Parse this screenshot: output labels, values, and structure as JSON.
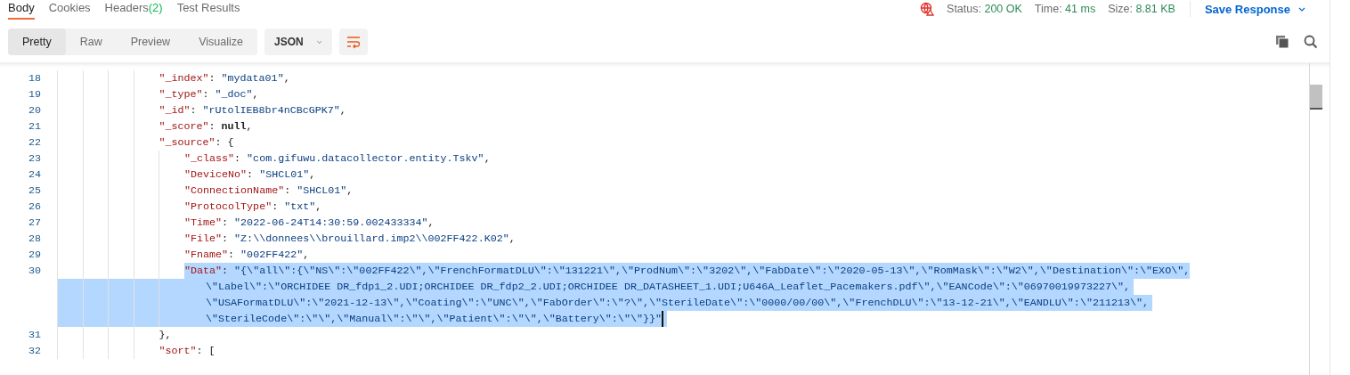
{
  "response_tabs": [
    {
      "label": "Body",
      "selected": true
    },
    {
      "label": "Cookies",
      "selected": false
    },
    {
      "label": "Headers",
      "count": "(2)",
      "selected": false
    },
    {
      "label": "Test Results",
      "selected": false
    }
  ],
  "status": [
    {
      "label": "Status:",
      "value": "200 OK"
    },
    {
      "label": "Time:",
      "value": "41 ms"
    },
    {
      "label": "Size:",
      "value": "8.81 KB"
    }
  ],
  "save_button": "Save Response",
  "view_modes": [
    {
      "label": "Pretty",
      "selected": true
    },
    {
      "label": "Raw",
      "selected": false
    },
    {
      "label": "Preview",
      "selected": false
    },
    {
      "label": "Visualize",
      "selected": false
    }
  ],
  "format_dropdown": "JSON",
  "wrap_lines": true,
  "lines": [
    {
      "number": "18",
      "tokens": [
        {
          "kind": "key",
          "text": "\"_index\""
        },
        {
          "kind": "punct",
          "text": ": "
        },
        {
          "kind": "string",
          "text": "\"mydata01\""
        },
        {
          "kind": "punct",
          "text": ","
        }
      ]
    },
    {
      "number": "19",
      "tokens": [
        {
          "kind": "key",
          "text": "\"_type\""
        },
        {
          "kind": "punct",
          "text": ": "
        },
        {
          "kind": "string",
          "text": "\"_doc\""
        },
        {
          "kind": "punct",
          "text": ","
        }
      ]
    },
    {
      "number": "20",
      "tokens": [
        {
          "kind": "key",
          "text": "\"_id\""
        },
        {
          "kind": "punct",
          "text": ": "
        },
        {
          "kind": "string",
          "text": "\"rUtolIEB8br4nCBcGPK7\""
        },
        {
          "kind": "punct",
          "text": ","
        }
      ]
    },
    {
      "number": "21",
      "tokens": [
        {
          "kind": "key",
          "text": "\"_score\""
        },
        {
          "kind": "punct",
          "text": ": "
        },
        {
          "kind": "keyword",
          "text": "null"
        },
        {
          "kind": "punct",
          "text": ","
        }
      ]
    },
    {
      "number": "22",
      "tokens": [
        {
          "kind": "key",
          "text": "\"_source\""
        },
        {
          "kind": "punct",
          "text": ": {"
        }
      ],
      "children": [
        {
          "number": "23",
          "tokens": [
            {
              "kind": "key",
              "text": "\"_class\""
            },
            {
              "kind": "punct",
              "text": ": "
            },
            {
              "kind": "string",
              "text": "\"com.gifuwu.datacollector.entity.Tskv\""
            },
            {
              "kind": "punct",
              "text": ","
            }
          ]
        },
        {
          "number": "24",
          "tokens": [
            {
              "kind": "key",
              "text": "\"DeviceNo\""
            },
            {
              "kind": "punct",
              "text": ": "
            },
            {
              "kind": "string",
              "text": "\"SHCL01\""
            },
            {
              "kind": "punct",
              "text": ","
            }
          ]
        },
        {
          "number": "25",
          "tokens": [
            {
              "kind": "key",
              "text": "\"ConnectionName\""
            },
            {
              "kind": "punct",
              "text": ": "
            },
            {
              "kind": "string",
              "text": "\"SHCL01\""
            },
            {
              "kind": "punct",
              "text": ","
            }
          ]
        },
        {
          "number": "26",
          "tokens": [
            {
              "kind": "key",
              "text": "\"ProtocolType\""
            },
            {
              "kind": "punct",
              "text": ": "
            },
            {
              "kind": "string",
              "text": "\"txt\""
            },
            {
              "kind": "punct",
              "text": ","
            }
          ]
        },
        {
          "number": "27",
          "tokens": [
            {
              "kind": "key",
              "text": "\"Time\""
            },
            {
              "kind": "punct",
              "text": ": "
            },
            {
              "kind": "string",
              "text": "\"2022-06-24T14:30:59.002433334\""
            },
            {
              "kind": "punct",
              "text": ","
            }
          ]
        },
        {
          "number": "28",
          "tokens": [
            {
              "kind": "key",
              "text": "\"File\""
            },
            {
              "kind": "punct",
              "text": ": "
            },
            {
              "kind": "string",
              "text": "\"Z:\\\\donnees\\\\brouillard.imp2\\\\002FF422.K02\""
            },
            {
              "kind": "punct",
              "text": ","
            }
          ]
        },
        {
          "number": "29",
          "tokens": [
            {
              "kind": "key",
              "text": "\"Fname\""
            },
            {
              "kind": "punct",
              "text": ": "
            },
            {
              "kind": "string",
              "text": "\"002FF422\""
            },
            {
              "kind": "punct",
              "text": ","
            }
          ]
        },
        {
          "number": "30",
          "selected": true,
          "tokens": [
            {
              "kind": "key",
              "text": "\"Data\""
            },
            {
              "kind": "punct",
              "text": ": "
            }
          ],
          "wrapped": [
            "\"{\\\"all\\\":{\\\"NS\\\":\\\"002FF422\\\",\\\"FrenchFormatDLU\\\":\\\"131221\\\",\\\"ProdNum\\\":\\\"3202\\\",\\\"FabDate\\\":\\\"2020-05-13\\\",\\\"RomMask\\\":\\\"W2\\\",\\\"Destination\\\":\\\"EXO\\\",",
            "\\\"Label\\\":\\\"ORCHIDEE DR_fdp1_2.UDI;ORCHIDEE DR_fdp2_2.UDI;ORCHIDEE DR_DATASHEET_1.UDI;U646A_Leaflet_Pacemakers.pdf\\\",\\\"EANCode\\\":\\\"06970019973227\\\",",
            "\\\"USAFormatDLU\\\":\\\"2021-12-13\\\",\\\"Coating\\\":\\\"UNC\\\",\\\"FabOrder\\\":\\\"?\\\",\\\"SterileDate\\\":\\\"0000/00/00\\\",\\\"FrenchDLU\\\":\\\"13-12-21\\\",\\\"EANDLU\\\":\\\"211213\\\",",
            "\\\"SterileCode\\\":\\\"\\\",\\\"Manual\\\":\\\"\\\",\\\"Patient\\\":\\\"\\\",\\\"Battery\\\":\\\"\\\"}}\""
          ]
        }
      ]
    },
    {
      "number": "31",
      "tokens": [
        {
          "kind": "punct",
          "text": "},"
        }
      ]
    },
    {
      "number": "32",
      "tokens": [
        {
          "kind": "key",
          "text": "\"sort\""
        },
        {
          "kind": "punct",
          "text": ": ["
        }
      ]
    }
  ]
}
